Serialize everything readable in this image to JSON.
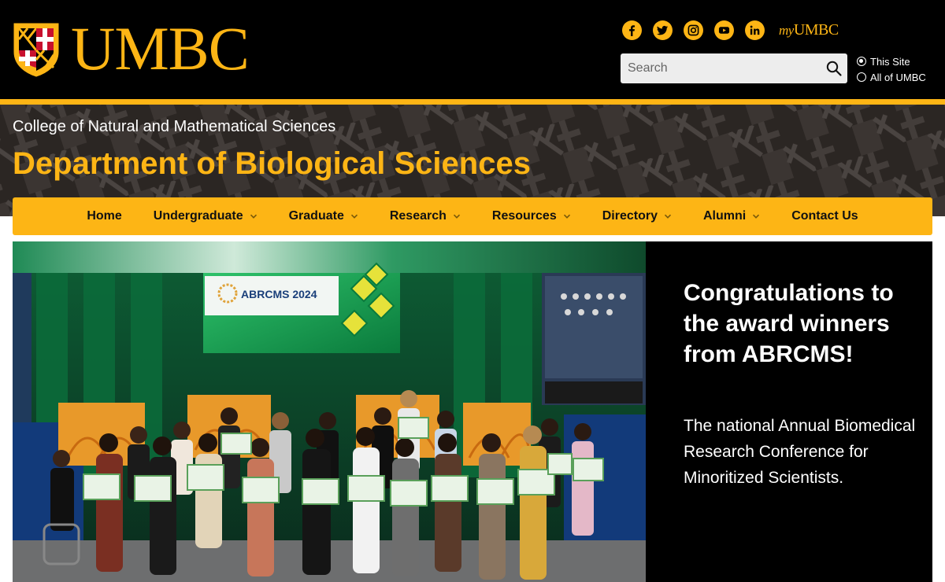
{
  "brand": {
    "wordmark": "UMBC",
    "my_prefix": "my",
    "my_suffix": "UMBC"
  },
  "social": [
    {
      "name": "facebook-icon",
      "glyph": "f"
    },
    {
      "name": "twitter-icon",
      "glyph": ""
    },
    {
      "name": "instagram-icon",
      "glyph": ""
    },
    {
      "name": "youtube-icon",
      "glyph": ""
    },
    {
      "name": "linkedin-icon",
      "glyph": "in"
    }
  ],
  "search": {
    "placeholder": "Search",
    "value": ""
  },
  "scope": {
    "option_site": "This Site",
    "option_all": "All of UMBC",
    "selected": "This Site"
  },
  "header": {
    "college": "College of Natural and Mathematical Sciences",
    "department": "Department of Biological Sciences"
  },
  "nav": {
    "home": "Home",
    "undergraduate": "Undergraduate",
    "graduate": "Graduate",
    "research": "Research",
    "resources": "Resources",
    "directory": "Directory",
    "alumni": "Alumni",
    "contact": "Contact Us"
  },
  "hero": {
    "title": "Congratulations to the award winners from ABRCMS!",
    "body": "The national Annual Biomedical Research Conference for Minoritized Scientists.",
    "screen_text": "ABRCMS 2024"
  },
  "colors": {
    "gold": "#fdb515",
    "black": "#000000",
    "banner": "#2b2623"
  }
}
